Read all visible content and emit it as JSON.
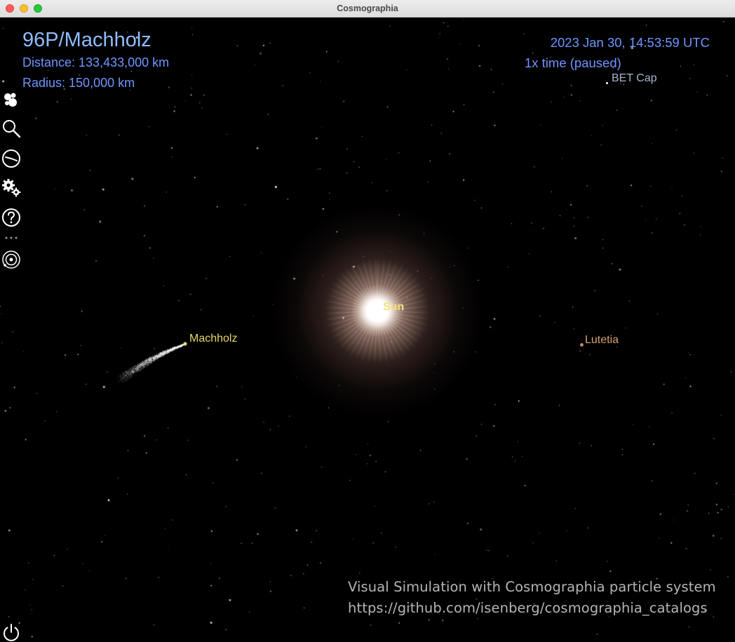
{
  "window": {
    "title": "Cosmographia"
  },
  "hud": {
    "object_name": "96P/Machholz",
    "distance": "Distance: 133,433,000 km",
    "radius": "Radius: 150,000 km",
    "datetime": "2023 Jan 30, 14:53:59 UTC",
    "time_rate": "1x time (paused)"
  },
  "labels": {
    "sun": "Sun",
    "machholz": "Machholz",
    "lutetia": "Lutetia",
    "bet_cap": "BET Cap"
  },
  "toolbar": {
    "items": [
      {
        "name": "solar-system-browser",
        "icon": "planets-icon"
      },
      {
        "name": "find-object",
        "icon": "search-icon"
      },
      {
        "name": "time-control",
        "icon": "clock-icon"
      },
      {
        "name": "settings",
        "icon": "gears-icon"
      },
      {
        "name": "help",
        "icon": "help-icon"
      },
      {
        "name": "more",
        "icon": "ellipsis-icon"
      },
      {
        "name": "observer-view",
        "icon": "orbit-icon"
      }
    ],
    "quit_icon": "power-icon"
  },
  "credit": {
    "line1": "Visual Simulation with Cosmographia particle system",
    "line2": "https://github.com/isenberg/cosmographia_catalogs"
  },
  "colors": {
    "hud_title": "#8fbcff",
    "hud_text": "#6f95ff",
    "sun_label": "#f3e27a",
    "machholz_label": "#e6d86a",
    "lutetia_label": "#d4a070",
    "star_label": "#a8b4d0",
    "credit_text": "#b5b5b5"
  }
}
